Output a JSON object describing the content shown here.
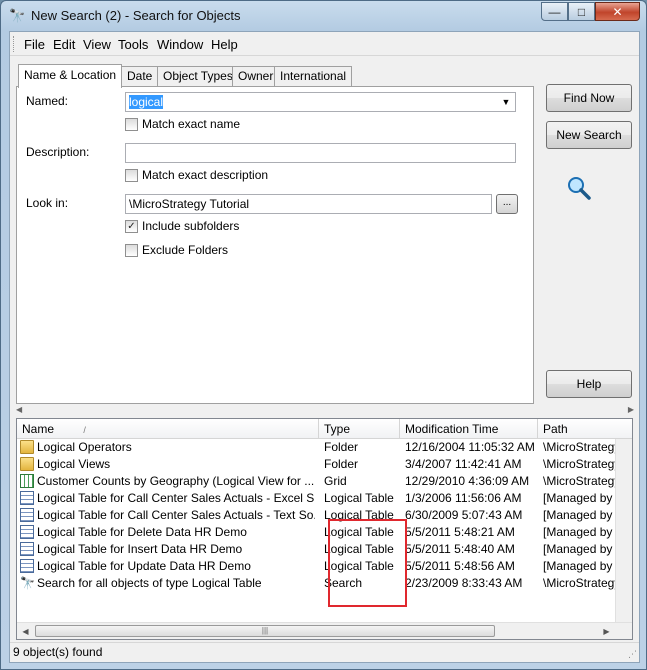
{
  "window": {
    "title": "New Search (2) - Search for Objects",
    "icon": "binoculars-icon",
    "controls": {
      "minimize": "—",
      "maximize": "□",
      "close": "✕"
    }
  },
  "menu": [
    {
      "label": "File"
    },
    {
      "label": "Edit"
    },
    {
      "label": "View"
    },
    {
      "label": "Tools"
    },
    {
      "label": "Window"
    },
    {
      "label": "Help"
    }
  ],
  "tabs": [
    {
      "label": "Name & Location",
      "active": true
    },
    {
      "label": "Date"
    },
    {
      "label": "Object Types"
    },
    {
      "label": "Owner"
    },
    {
      "label": "International"
    }
  ],
  "form": {
    "named_label": "Named:",
    "named_value": "logical",
    "match_exact_name": "Match exact name",
    "description_label": "Description:",
    "description_value": "",
    "match_exact_description": "Match exact description",
    "look_in_label": "Look in:",
    "look_in_value": "\\MicroStrategy Tutorial",
    "browse_label": "...",
    "include_subfolders": "Include subfolders",
    "include_subfolders_checked": true,
    "exclude_folders": "Exclude Folders",
    "exclude_folders_checked": false
  },
  "buttons": {
    "find_now": "Find Now",
    "new_search": "New Search",
    "help": "Help"
  },
  "results": {
    "columns": [
      "Name",
      "Type",
      "Modification Time",
      "Path"
    ],
    "rows": [
      {
        "icon": "folder-icon",
        "name": "Logical Operators",
        "type": "Folder",
        "time": "12/16/2004 11:05:32 AM",
        "path": "\\MicroStrategy T"
      },
      {
        "icon": "folder-icon",
        "name": "Logical Views",
        "type": "Folder",
        "time": "3/4/2007 11:42:41 AM",
        "path": "\\MicroStrategy T"
      },
      {
        "icon": "grid-icon",
        "name": "Customer Counts by Geography (Logical View for ...",
        "type": "Grid",
        "time": "12/29/2010 4:36:09 AM",
        "path": "\\MicroStrategy T"
      },
      {
        "icon": "table-icon",
        "name": "Logical Table for Call Center Sales Actuals - Excel S...",
        "type": "Logical Table",
        "time": "1/3/2006 11:56:06 AM",
        "path": "[Managed by the"
      },
      {
        "icon": "table-icon",
        "name": "Logical Table for Call Center Sales Actuals - Text So...",
        "type": "Logical Table",
        "time": "6/30/2009 5:07:43 AM",
        "path": "[Managed by the"
      },
      {
        "icon": "table-icon",
        "name": "Logical Table for Delete Data HR Demo",
        "type": "Logical Table",
        "time": "5/5/2011 5:48:21 AM",
        "path": "[Managed by the"
      },
      {
        "icon": "table-icon",
        "name": "Logical Table for Insert Data HR Demo",
        "type": "Logical Table",
        "time": "5/5/2011 5:48:40 AM",
        "path": "[Managed by the"
      },
      {
        "icon": "table-icon",
        "name": "Logical Table for Update Data HR Demo",
        "type": "Logical Table",
        "time": "5/5/2011 5:48:56 AM",
        "path": "[Managed by the"
      },
      {
        "icon": "search-icon",
        "name": "Search for all objects of type Logical Table",
        "type": "Search",
        "time": "2/23/2009 8:33:43 AM",
        "path": "\\MicroStrategy T"
      }
    ]
  },
  "status": "9 object(s) found",
  "accent_color": "#3399ff",
  "highlight_color": "#e0282e"
}
